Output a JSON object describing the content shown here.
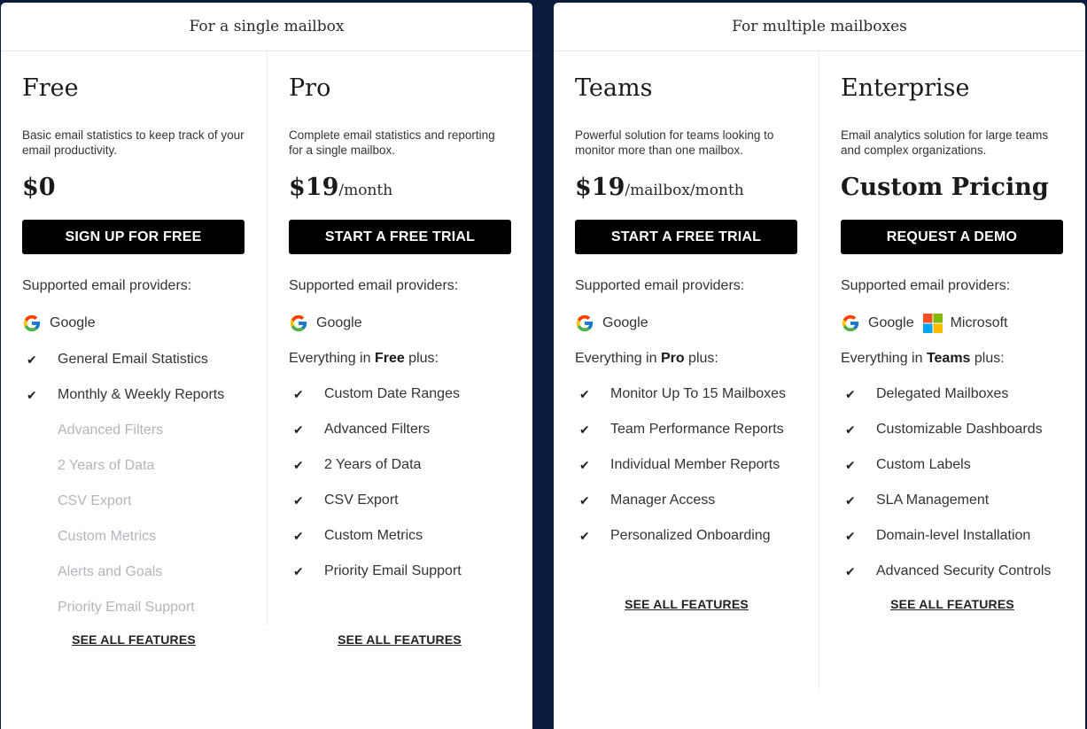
{
  "colors": {
    "page_bg": "#0c1c3f",
    "card_bg": "#ffffff",
    "button_bg": "#000000",
    "button_text": "#ffffff",
    "disabled_text": "#b2b5bd"
  },
  "groups": [
    {
      "title": "For a single mailbox",
      "plans": [
        {
          "name": "Free",
          "description": "Basic email statistics to keep track of your email productivity.",
          "price": "$0",
          "price_unit": "",
          "cta": "SIGN UP FOR FREE",
          "providers_label": "Supported email providers:",
          "providers": [
            {
              "name": "Google",
              "icon": "google-icon"
            }
          ],
          "everything_prefix": "",
          "everything_plan": "",
          "everything_suffix": "",
          "features": [
            {
              "label": "General Email Statistics",
              "included": true
            },
            {
              "label": "Monthly & Weekly Reports",
              "included": true
            },
            {
              "label": "Advanced Filters",
              "included": false
            },
            {
              "label": "2 Years of Data",
              "included": false
            },
            {
              "label": "CSV Export",
              "included": false
            },
            {
              "label": "Custom Metrics",
              "included": false
            },
            {
              "label": "Alerts and Goals",
              "included": false
            },
            {
              "label": "Priority Email Support",
              "included": false
            }
          ],
          "see_all": "SEE ALL FEATURES"
        },
        {
          "name": "Pro",
          "description": "Complete email statistics and reporting for a single mailbox.",
          "price": "$19",
          "price_unit": "/month",
          "cta": "START A FREE TRIAL",
          "providers_label": "Supported email providers:",
          "providers": [
            {
              "name": "Google",
              "icon": "google-icon"
            }
          ],
          "everything_prefix": "Everything in ",
          "everything_plan": "Free",
          "everything_suffix": " plus:",
          "features": [
            {
              "label": "Custom Date Ranges",
              "included": true
            },
            {
              "label": "Advanced Filters",
              "included": true
            },
            {
              "label": "2 Years of Data",
              "included": true
            },
            {
              "label": "CSV Export",
              "included": true
            },
            {
              "label": "Custom Metrics",
              "included": true
            },
            {
              "label": "Priority Email Support",
              "included": true
            }
          ],
          "see_all": "SEE ALL FEATURES"
        }
      ]
    },
    {
      "title": "For multiple mailboxes",
      "plans": [
        {
          "name": "Teams",
          "description": "Powerful solution for teams looking to monitor more than one mailbox.",
          "price": "$19",
          "price_unit": "/mailbox/month",
          "cta": "START A FREE TRIAL",
          "providers_label": "Supported email providers:",
          "providers": [
            {
              "name": "Google",
              "icon": "google-icon"
            }
          ],
          "everything_prefix": "Everything in ",
          "everything_plan": "Pro",
          "everything_suffix": " plus:",
          "features": [
            {
              "label": "Monitor Up To 15 Mailboxes",
              "included": true
            },
            {
              "label": "Team Performance Reports",
              "included": true
            },
            {
              "label": "Individual Member Reports",
              "included": true
            },
            {
              "label": "Manager Access",
              "included": true
            },
            {
              "label": "Personalized Onboarding",
              "included": true
            }
          ],
          "see_all": "SEE ALL FEATURES"
        },
        {
          "name": "Enterprise",
          "description": "Email analytics solution for large teams and complex organizations.",
          "price": "Custom Pricing",
          "price_unit": "",
          "cta": "REQUEST A DEMO",
          "providers_label": "Supported email providers:",
          "providers": [
            {
              "name": "Google",
              "icon": "google-icon"
            },
            {
              "name": "Microsoft",
              "icon": "microsoft-icon"
            }
          ],
          "everything_prefix": "Everything in ",
          "everything_plan": "Teams",
          "everything_suffix": " plus:",
          "features": [
            {
              "label": "Delegated Mailboxes",
              "included": true
            },
            {
              "label": "Customizable Dashboards",
              "included": true
            },
            {
              "label": "Custom Labels",
              "included": true
            },
            {
              "label": "SLA Management",
              "included": true
            },
            {
              "label": "Domain-level Installation",
              "included": true
            },
            {
              "label": "Advanced Security Controls",
              "included": true
            }
          ],
          "see_all": "SEE ALL FEATURES"
        }
      ]
    }
  ]
}
